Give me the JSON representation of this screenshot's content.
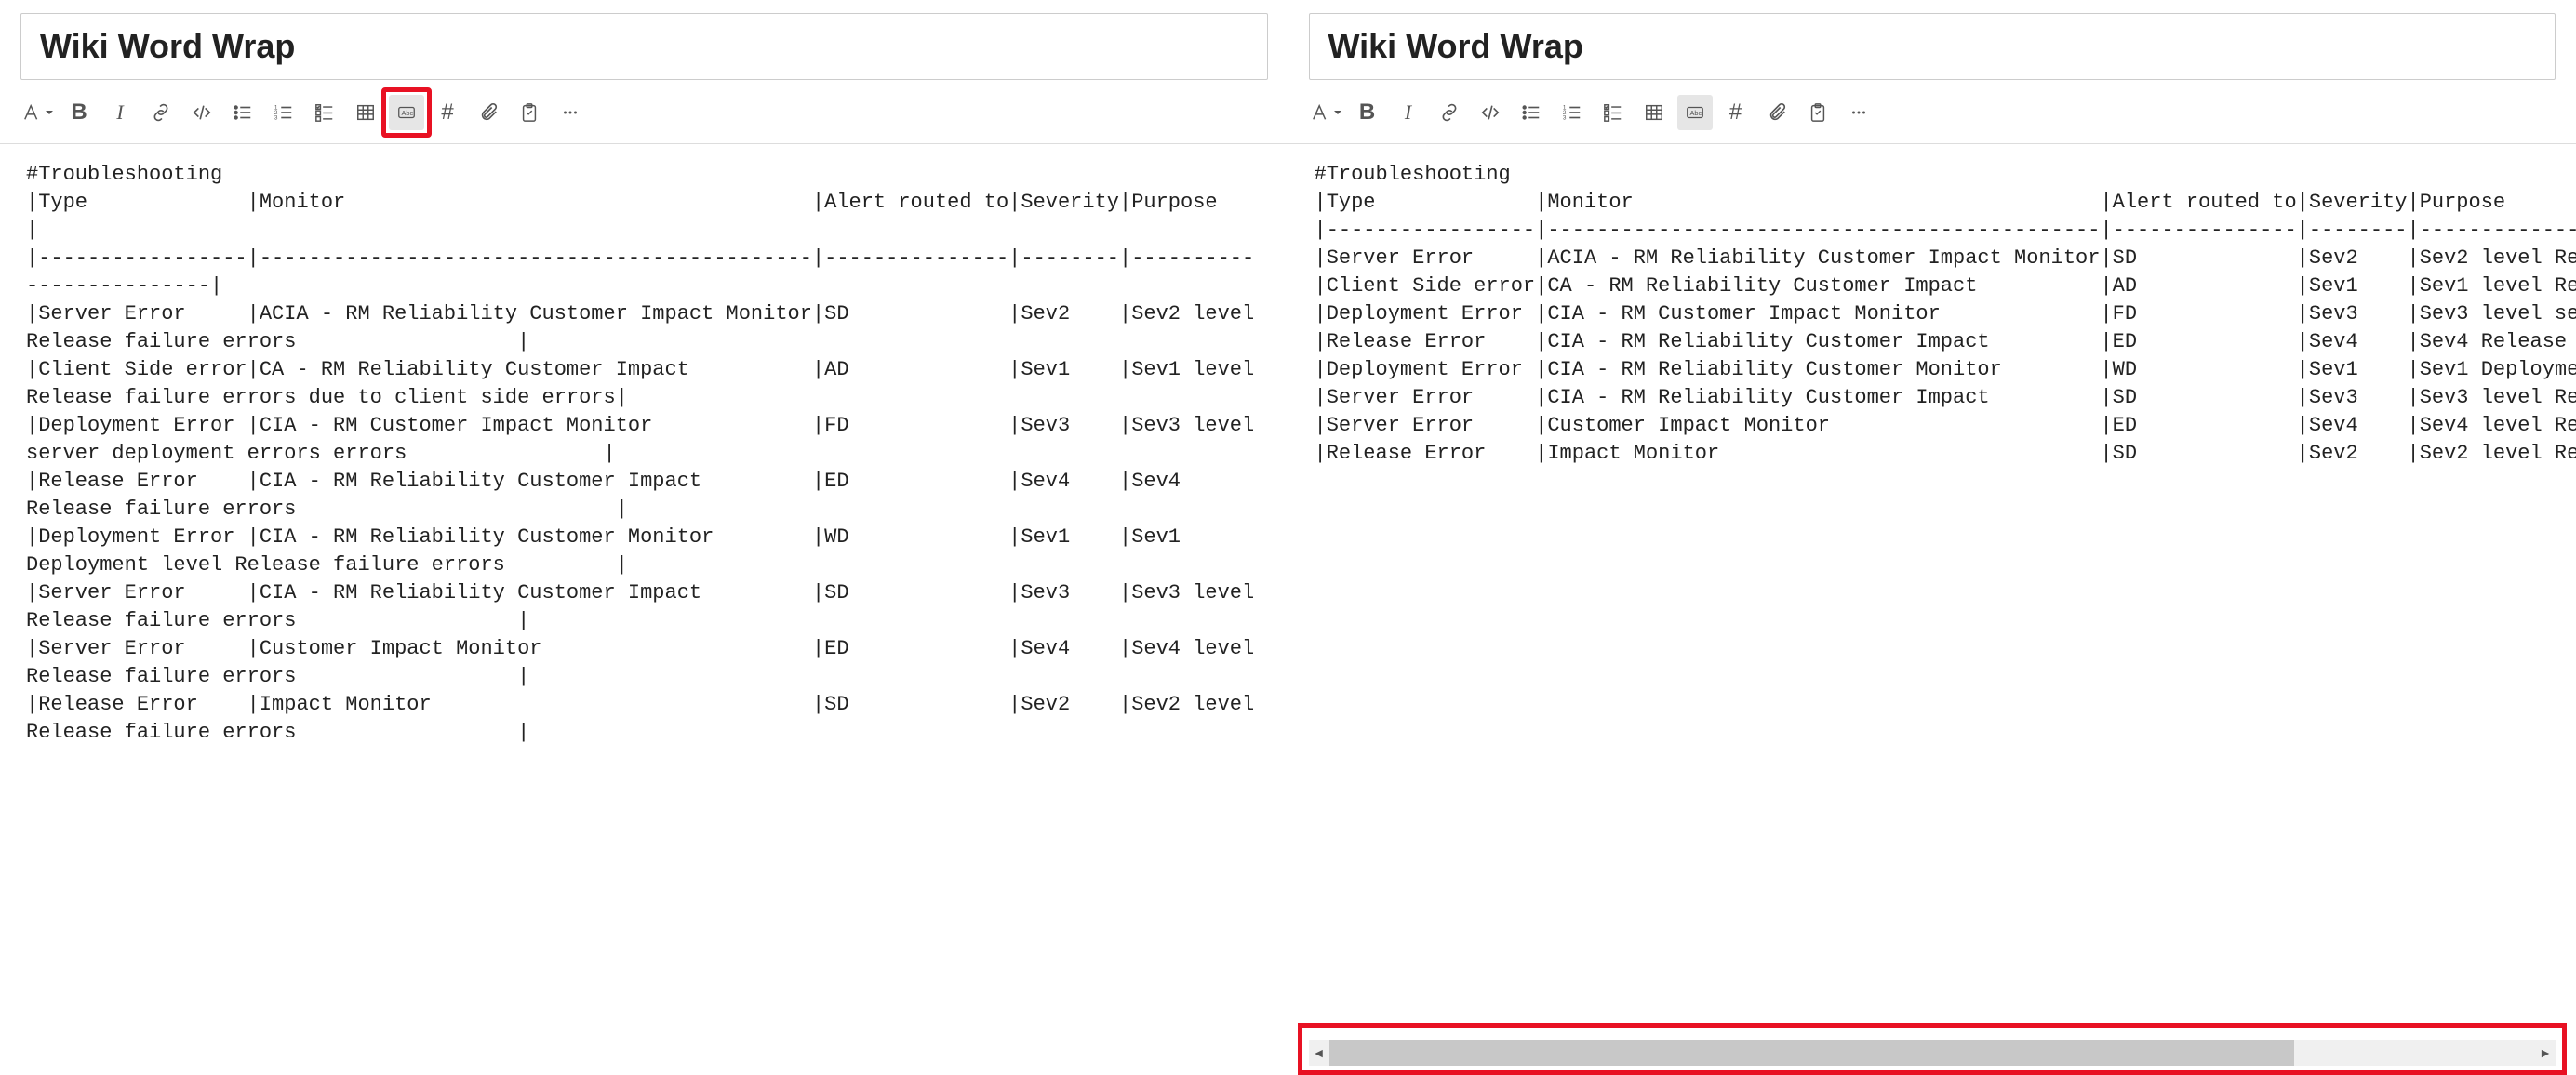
{
  "common": {
    "title": "Wiki Word Wrap",
    "toolbar_icons": [
      "format-icon",
      "bold-icon",
      "italic-icon",
      "link-icon",
      "code-snippet-icon",
      "bulleted-list-icon",
      "numbered-list-icon",
      "checklist-icon",
      "table-icon",
      "word-wrap-icon",
      "hash-icon",
      "attachment-icon",
      "work-item-icon",
      "more-icon"
    ]
  },
  "raw_markdown": {
    "heading": "#Troubleshooting",
    "columns": [
      "Type",
      "Monitor",
      "Alert routed to",
      "Severity",
      "Purpose"
    ],
    "rows": [
      {
        "type": "Server Error",
        "monitor": "ACIA - RM Reliability Customer Impact Monitor",
        "alert": "SD",
        "sev": "Sev2",
        "purpose": "Sev2 level Release failure errors"
      },
      {
        "type": "Client Side error",
        "monitor": "CA - RM Reliability Customer Impact",
        "alert": "AD",
        "sev": "Sev1",
        "purpose": "Sev1 level Release failure errors due to client side errors"
      },
      {
        "type": "Deployment Error",
        "monitor": "CIA - RM Customer Impact Monitor",
        "alert": "FD",
        "sev": "Sev3",
        "purpose": "Sev3 level server deployment errors errors"
      },
      {
        "type": "Release Error",
        "monitor": "CIA - RM Reliability Customer Impact",
        "alert": "ED",
        "sev": "Sev4",
        "purpose": "Sev4 Release failure errors"
      },
      {
        "type": "Deployment Error",
        "monitor": "CIA - RM Reliability Customer Monitor",
        "alert": "WD",
        "sev": "Sev1",
        "purpose": "Sev1 Deployment level Release failure errors"
      },
      {
        "type": "Server Error",
        "monitor": "CIA - RM Reliability Customer Impact",
        "alert": "SD",
        "sev": "Sev3",
        "purpose": "Sev3 level Release failure errors"
      },
      {
        "type": "Server Error",
        "monitor": "Customer Impact Monitor",
        "alert": "ED",
        "sev": "Sev4",
        "purpose": "Sev4 level Release failure errors"
      },
      {
        "type": "Release Error",
        "monitor": "Impact Monitor",
        "alert": "SD",
        "sev": "Sev2",
        "purpose": "Sev2 level Release failure errors"
      }
    ]
  },
  "left": {
    "word_wrap_active": true,
    "content_text": "#Troubleshooting\n|Type             |Monitor                                      |Alert routed to|Severity|Purpose                  |\n|-----------------|---------------------------------------------|---------------|--------|-------------------------|\n|Server Error     |ACIA - RM Reliability Customer Impact Monitor|SD             |Sev2    |Sev2 level Release failure errors                  |\n|Client Side error|CA - RM Reliability Customer Impact          |AD             |Sev1    |Sev1 level Release failure errors due to client side errors|\n|Deployment Error |CIA - RM Customer Impact Monitor             |FD             |Sev3    |Sev3 level server deployment errors errors                |\n|Release Error    |CIA - RM Reliability Customer Impact         |ED             |Sev4    |Sev4 Release failure errors                          |\n|Deployment Error |CIA - RM Reliability Customer Monitor        |WD             |Sev1    |Sev1 Deployment level Release failure errors         |\n|Server Error     |CIA - RM Reliability Customer Impact         |SD             |Sev3    |Sev3 level Release failure errors                  |\n|Server Error     |Customer Impact Monitor                      |ED             |Sev4    |Sev4 level Release failure errors                  |\n|Release Error    |Impact Monitor                               |SD             |Sev2    |Sev2 level Release failure errors                  |\n"
  },
  "right": {
    "word_wrap_active": false,
    "content_text": "#Troubleshooting\n|Type             |Monitor                                      |Alert routed to|Severity|Purpose                  \n|-----------------|---------------------------------------------|---------------|--------|-------------------------\n|Server Error     |ACIA - RM Reliability Customer Impact Monitor|SD             |Sev2    |Sev2 level Release failure errors\n|Client Side error|CA - RM Reliability Customer Impact          |AD             |Sev1    |Sev1 level Release failure errors due to client side errors\n|Deployment Error |CIA - RM Customer Impact Monitor             |FD             |Sev3    |Sev3 level server deployment errors errors\n|Release Error    |CIA - RM Reliability Customer Impact         |ED             |Sev4    |Sev4 Release failure errors\n|Deployment Error |CIA - RM Reliability Customer Monitor        |WD             |Sev1    |Sev1 Deployment level Release failure errors\n|Server Error     |CIA - RM Reliability Customer Impact         |SD             |Sev3    |Sev3 level Release failure errors\n|Server Error     |Customer Impact Monitor                      |ED             |Sev4    |Sev4 level Release failure errors\n|Release Error    |Impact Monitor                               |SD             |Sev2    |Sev2 level Release failure errors\n"
  }
}
